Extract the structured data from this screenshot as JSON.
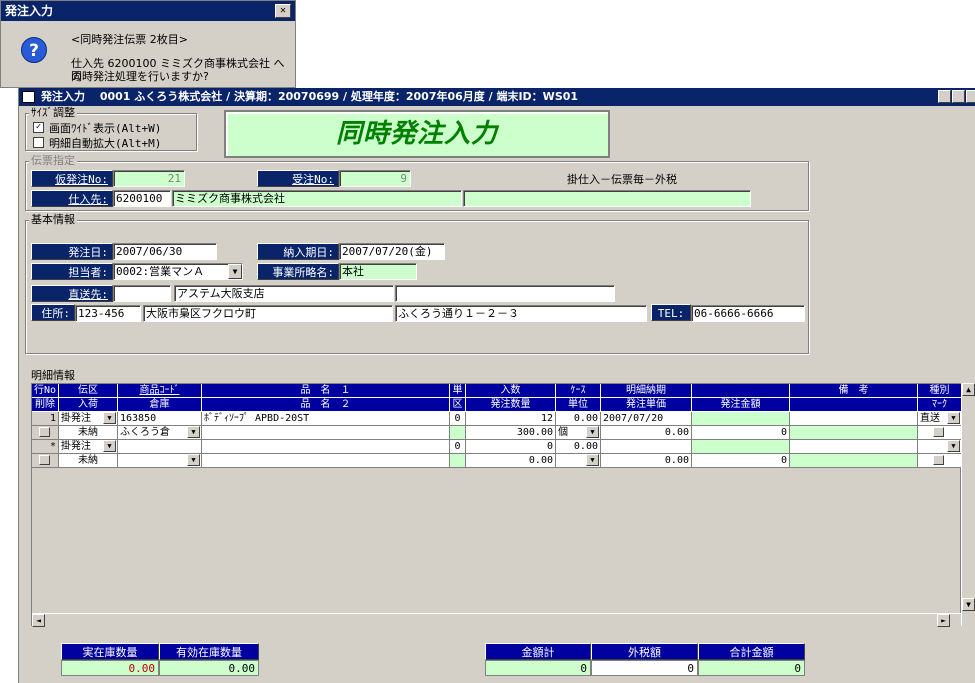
{
  "dialog": {
    "title": "発注入力",
    "close": "✕",
    "line1": "<同時発注伝票 2枚目>",
    "line2": "仕入先 6200100 ミミズク商事株式会社 への",
    "line3": "同時発注処理を行いますか?"
  },
  "window": {
    "title": "発注入力　 0001 ふくろう株式会社 / 決算期：20070699 / 処理年度：2007年06月度 / 端末ID：WS01"
  },
  "size_group": {
    "label": "ｻｲｽﾞ調整",
    "wide_label": "画面ﾜｲﾄﾞ表示(Alt+W)",
    "wide_checked": true,
    "auto_label": "明細自動拡大(Alt+M)",
    "auto_checked": false
  },
  "banner": "同時発注入力",
  "slip_group": {
    "label": "伝票指定",
    "temp_no_label": "仮発注No:",
    "temp_no": "21",
    "order_no_label": "受注No:",
    "order_no": "9",
    "slip_type": "掛仕入－伝票毎－外税",
    "supplier_label": "仕入先:",
    "supplier_code": "6200100",
    "supplier_name": "ミミズク商事株式会社",
    "supplier_extra": ""
  },
  "basic_group": {
    "label": "基本情報",
    "order_date_label": "発注日:",
    "order_date": "2007/06/30",
    "delivery_label": "納入期日:",
    "delivery_date": "2007/07/20(金)",
    "staff_label": "担当者:",
    "staff": "0002:営業マンＡ",
    "office_label": "事業所略名:",
    "office": "本社",
    "direct_label": "直送先:",
    "direct_code": "",
    "direct_name": "アステム大阪支店",
    "direct_extra": "",
    "address_label": "住所:",
    "zip": "123-456",
    "address1": "大阪市梟区フクロウ町",
    "address2": "ふくろう通り１－２－３",
    "tel_label": "TEL:",
    "tel": "06-6666-6666"
  },
  "detail_group": {
    "label": "明細情報",
    "headers_top": [
      "行No",
      "伝区",
      "商品ｺｰﾄﾞ",
      "品　名　１",
      "単",
      "入数",
      "ｹｰｽ",
      "明細納期",
      "",
      "備　考",
      "種別"
    ],
    "headers_bottom": [
      "削除",
      "入荷",
      "倉庫",
      "品　名　２",
      "区",
      "発注数量",
      "単位",
      "発注単価",
      "発注金額",
      "",
      "ﾏｰｸ"
    ],
    "rows": [
      {
        "no": "1",
        "type": "掛発注",
        "code": "163850",
        "name1": "ﾎﾞﾃﾞｨｿｰﾌﾟ APBD-20ST",
        "unit_kbn": "0",
        "qty_in": "12",
        "case": "0.00",
        "due": "2007/07/20",
        "note": "",
        "kind": "直送",
        "arrival": "未納",
        "warehouse": "ふくろう倉",
        "name2": "",
        "order_qty": "300.00",
        "unit": "個",
        "price": "0.00",
        "amount": "0"
      },
      {
        "no": "*",
        "type": "掛発注",
        "code": "",
        "name1": "",
        "unit_kbn": "0",
        "qty_in": "0",
        "case": "0.00",
        "due": "",
        "note": "",
        "kind": "",
        "arrival": "未納",
        "warehouse": "",
        "name2": "",
        "order_qty": "0.00",
        "unit": "",
        "price": "0.00",
        "amount": "0"
      }
    ]
  },
  "totals": {
    "stock_label": "実在庫数量",
    "stock": "0.00",
    "avail_label": "有効在庫数量",
    "avail": "0.00",
    "sum_label": "金額計",
    "sum": "0",
    "tax_label": "外税額",
    "tax": "0",
    "total_label": "合計金額",
    "total": "0"
  },
  "colors": {
    "title_bar": "#0a246a",
    "label_bg": "#0a246a",
    "header_bg": "#0000a0",
    "field_green": "#ccffcc",
    "banner_text": "#008000"
  }
}
